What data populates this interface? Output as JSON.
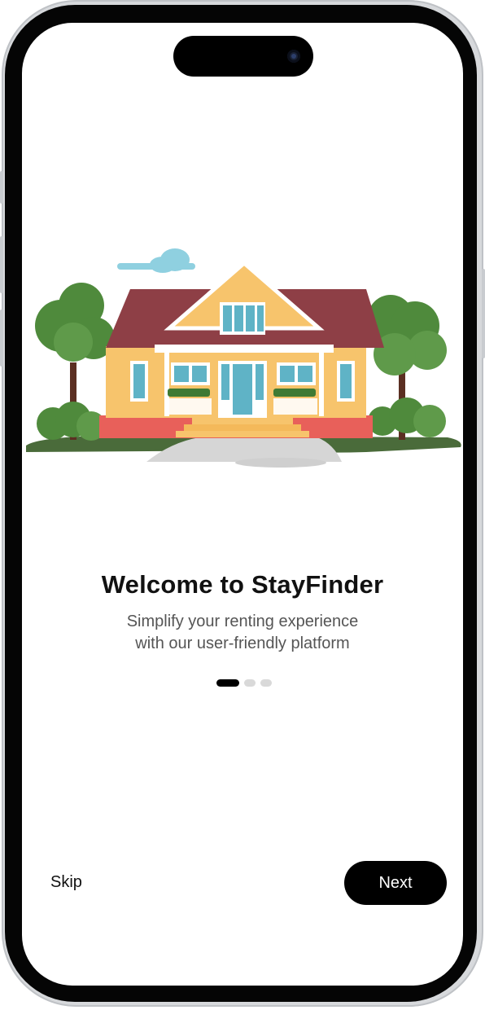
{
  "onboarding": {
    "title": "Welcome to StayFinder",
    "subtitle_line1": "Simplify your renting experience",
    "subtitle_line2": "with our user-friendly platform",
    "pages_total": 3,
    "current_page": 1
  },
  "actions": {
    "skip_label": "Skip",
    "next_label": "Next"
  },
  "illustration": "house-with-trees",
  "colors": {
    "primary": "#000000",
    "background": "#ffffff",
    "dot_inactive": "#d9d9d9",
    "text_secondary": "#555555"
  }
}
